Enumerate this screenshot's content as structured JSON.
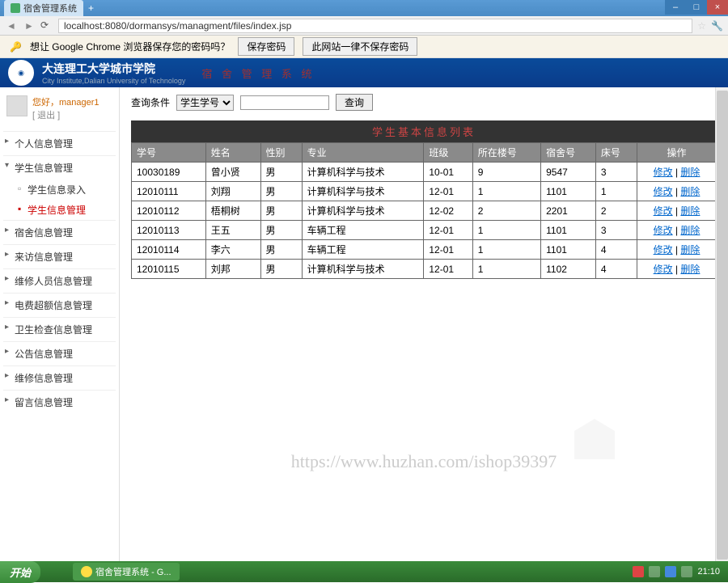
{
  "browser": {
    "tab_title": "宿舍管理系统",
    "url": "localhost:8080/dormansys/managment/files/index.jsp",
    "save_prompt": "想让 Google Chrome 浏览器保存您的密码吗？",
    "save_btn": "保存密码",
    "never_btn": "此网站一律不保存密码"
  },
  "app": {
    "logo_main": "大连理工大学城市学院",
    "logo_sub": "City Institute,Dalian University of Technology",
    "title": "宿 舍 管 理 系 统"
  },
  "user": {
    "greeting": "您好，manager1",
    "logout": "[ 退出 ]"
  },
  "sidebar": {
    "items": [
      {
        "label": "个人信息管理"
      },
      {
        "label": "学生信息管理"
      },
      {
        "label": "宿舍信息管理"
      },
      {
        "label": "来访信息管理"
      },
      {
        "label": "维修人员信息管理"
      },
      {
        "label": "电费超额信息管理"
      },
      {
        "label": "卫生检查信息管理"
      },
      {
        "label": "公告信息管理"
      },
      {
        "label": "维修信息管理"
      },
      {
        "label": "留言信息管理"
      }
    ],
    "sub": [
      {
        "label": "学生信息录入"
      },
      {
        "label": "学生信息管理"
      }
    ]
  },
  "query": {
    "label": "查询条件",
    "option": "学生学号",
    "placeholder": "",
    "btn": "查询"
  },
  "table": {
    "title": "学生基本信息列表",
    "headers": [
      "学号",
      "姓名",
      "性别",
      "专业",
      "班级",
      "所在楼号",
      "宿舍号",
      "床号",
      "操作"
    ],
    "op_edit": "修改",
    "op_del": "删除",
    "rows": [
      {
        "c": [
          "10030189",
          "曾小贤",
          "男",
          "计算机科学与技术",
          "10-01",
          "9",
          "9547",
          "3"
        ]
      },
      {
        "c": [
          "12010111",
          "刘翔",
          "男",
          "计算机科学与技术",
          "12-01",
          "1",
          "1101",
          "1"
        ]
      },
      {
        "c": [
          "12010112",
          "梧桐树",
          "男",
          "计算机科学与技术",
          "12-02",
          "2",
          "2201",
          "2"
        ]
      },
      {
        "c": [
          "12010113",
          "王五",
          "男",
          "车辆工程",
          "12-01",
          "1",
          "1101",
          "3"
        ]
      },
      {
        "c": [
          "12010114",
          "李六",
          "男",
          "车辆工程",
          "12-01",
          "1",
          "1101",
          "4"
        ]
      },
      {
        "c": [
          "12010115",
          "刘邦",
          "男",
          "计算机科学与技术",
          "12-01",
          "1",
          "1102",
          "4"
        ]
      }
    ]
  },
  "watermark": "https://www.huzhan.com/ishop39397",
  "taskbar": {
    "start": "开始",
    "item": "宿舍管理系统 - G...",
    "time": "21:10"
  }
}
